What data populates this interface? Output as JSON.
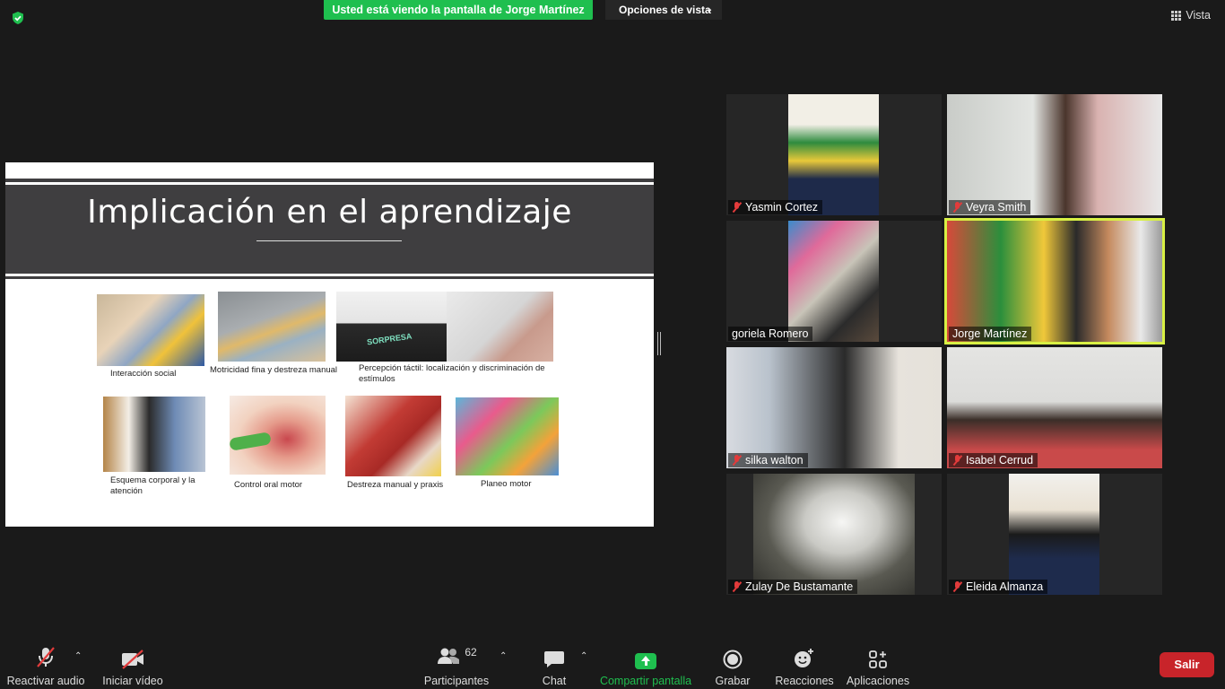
{
  "top": {
    "viewing_banner": "Usted está viendo la pantalla de Jorge Martínez",
    "view_options": "Opciones de vista",
    "vista": "Vista"
  },
  "slide": {
    "title": "Implicación en el aprendizaje",
    "captions": [
      "Interacción social",
      "Motricidad fina y destreza manual",
      "Percepción táctil: localización y discriminación de estímulos",
      "Esquema corporal y la atención",
      "Control oral motor",
      "Destreza manual y praxis",
      "Planeo motor"
    ],
    "box_label": "SORPRESA"
  },
  "participants": [
    {
      "name": "Yasmin Cortez",
      "muted": true
    },
    {
      "name": "Veyra Smith",
      "muted": true
    },
    {
      "name": "goriela Romero",
      "muted": false
    },
    {
      "name": "Jorge Martínez",
      "muted": false,
      "active": true
    },
    {
      "name": "silka walton",
      "muted": true
    },
    {
      "name": "Isabel Cerrud",
      "muted": true
    },
    {
      "name": "Zulay De Bustamante",
      "muted": true
    },
    {
      "name": "Eleida Almanza",
      "muted": true
    }
  ],
  "toolbar": {
    "audio": "Reactivar audio",
    "video": "Iniciar vídeo",
    "participants": "Participantes",
    "participants_count": "62",
    "chat": "Chat",
    "share": "Compartir pantalla",
    "record": "Grabar",
    "reactions": "Reacciones",
    "apps": "Aplicaciones",
    "leave": "Salir"
  },
  "colors": {
    "accent_green": "#1fbf4f",
    "leave_red": "#c8242a",
    "active_speaker": "#d8f044"
  }
}
